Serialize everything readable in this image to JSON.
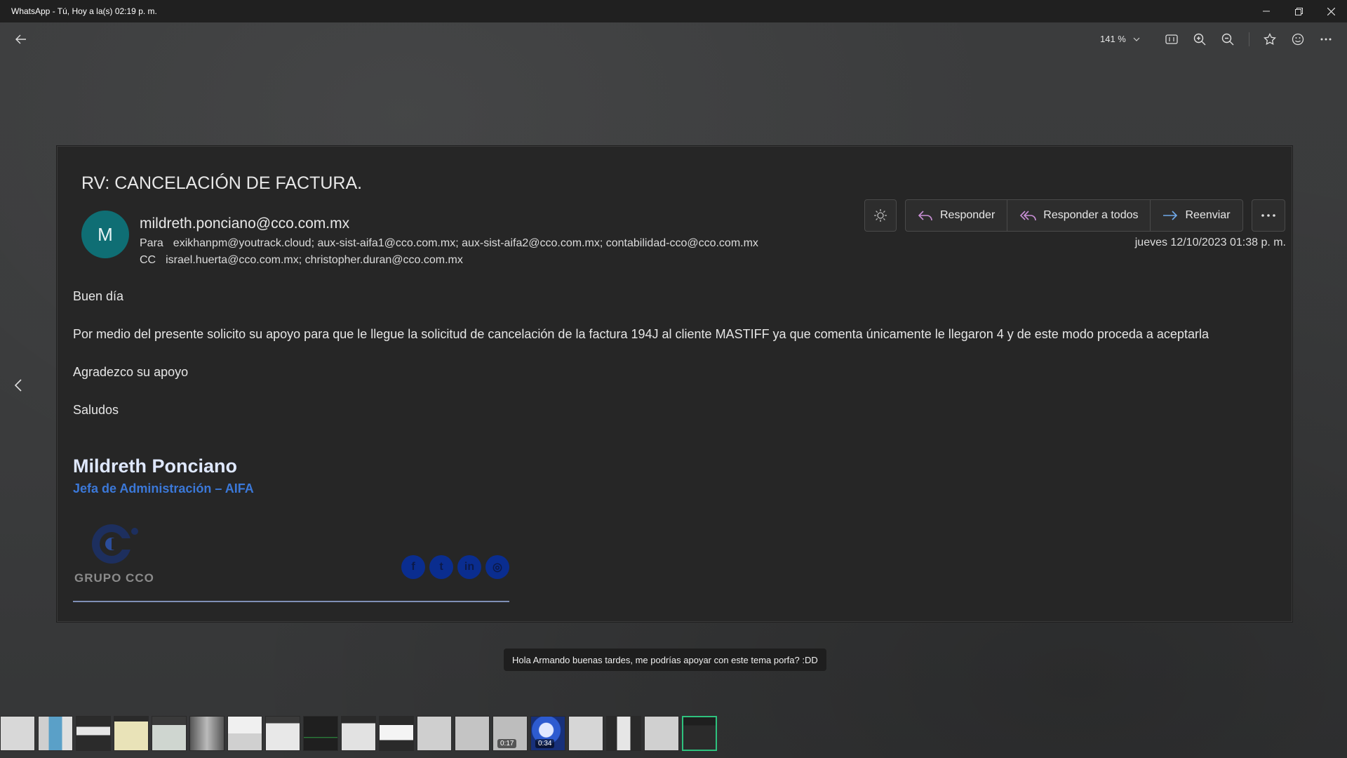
{
  "window": {
    "title": "WhatsApp - Tú, Hoy a la(s) 02:19 p. m."
  },
  "toolbar": {
    "zoom_level": "141 %"
  },
  "email": {
    "subject": "RV: CANCELACIÓN DE FACTURA.",
    "avatar_letter": "M",
    "sender": "mildreth.ponciano@cco.com.mx",
    "to_label": "Para",
    "to": "exikhanpm@youtrack.cloud; aux-sist-aifa1@cco.com.mx; aux-sist-aifa2@cco.com.mx; contabilidad-cco@cco.com.mx",
    "cc_label": "CC",
    "cc": "israel.huerta@cco.com.mx; christopher.duran@cco.com.mx",
    "date": "jueves 12/10/2023 01:38 p. m.",
    "actions": {
      "reply": "Responder",
      "reply_all": "Responder a todos",
      "forward": "Reenviar"
    },
    "body": {
      "greeting": "Buen día",
      "paragraph": "Por medio del presente solicito su apoyo para que le llegue la solicitud de cancelación de la factura 194J al cliente MASTIFF ya que comenta únicamente le llegaron 4 y de este modo proceda a aceptarla",
      "thanks": "Agradezco su apoyo",
      "closing": "Saludos"
    },
    "signature": {
      "name": "Mildreth Ponciano",
      "role": "Jefa de Administración – AIFA",
      "logo_text": "GRUPO CCO",
      "social": [
        "facebook-icon",
        "twitter-icon",
        "linkedin-icon",
        "instagram-icon"
      ]
    }
  },
  "caption": "Hola Armando buenas tardes, me podrías apoyar con este tema porfa? :DD",
  "filmstrip": {
    "durations": [
      "0:17",
      "0:34"
    ]
  },
  "colors": {
    "accent_link": "#3b78d8",
    "avatar_bg": "#0f6e74",
    "selected_thumb": "#2ec27e"
  }
}
